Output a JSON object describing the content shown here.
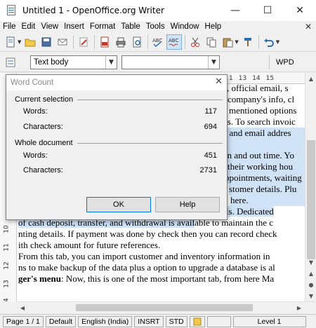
{
  "window": {
    "title": "Untitled 1 - OpenOffice.org Writer",
    "controls": {
      "minimize": "—",
      "maximize": "☐",
      "close": "✕"
    }
  },
  "menubar": {
    "items": [
      "File",
      "Edit",
      "View",
      "Insert",
      "Format",
      "Table",
      "Tools",
      "Window",
      "Help"
    ],
    "close_glyph": "✕"
  },
  "toolbar": {
    "icons": [
      "new-icon",
      "open-icon",
      "save-icon",
      "email-icon",
      "edit-file-icon",
      "export-pdf-icon",
      "print-icon",
      "page-preview-icon",
      "spellcheck-icon",
      "autospellcheck-icon",
      "cut-icon",
      "copy-icon",
      "paste-icon",
      "format-paintbrush-icon",
      "undo-icon"
    ]
  },
  "formatting": {
    "paragraph_style": "Text body",
    "font_name": "",
    "wpd_label": "WPD"
  },
  "ruler": {
    "ticks": [
      "1",
      "13",
      "14",
      "15"
    ]
  },
  "vruler": {
    "numbers": [
      "10",
      "11",
      "12",
      "13",
      "14",
      "15",
      "16"
    ]
  },
  "document": {
    "lines": [
      {
        "pre": "",
        "text": "s, official email, s",
        "hl": false
      },
      {
        "pre": "",
        "text": "company's info, cl",
        "hl": false
      },
      {
        "pre": "",
        "text": "mentioned options",
        "hl": false
      },
      {
        "pre": "",
        "text": "es. To search invoic",
        "hl": false
      },
      {
        "pre": "",
        "text": ", and email addres",
        "hl": true
      },
      {
        "pre": "",
        "text": "",
        "hl": true
      },
      {
        "pre": "",
        "text": "in and out time. Yo",
        "hl": true
      },
      {
        "pre": "",
        "text": "their working hou",
        "hl": true
      },
      {
        "pre": "",
        "text": "ppointments, waiting",
        "hl": true
      },
      {
        "pre": "",
        "text": "stomer details. Plu",
        "hl": true
      },
      {
        "pre": "",
        "text": "here.",
        "hl": true
      },
      {
        "pre_bold": "inting",
        "text": ": You can add, view, and edit various account details. Dedicated",
        "hl": true
      },
      {
        "pre": "",
        "text": " of cash deposit, transfer, and withdrawal is avail",
        "tail": "able to maintain the c",
        "hl": true
      },
      {
        "pre": "",
        "text": "nting details. If payment was done by check then you can record check",
        "hl": false
      },
      {
        "pre": "",
        "text": "ith check amount for future references.",
        "hl": false
      },
      {
        "pre": "",
        "text": " From this tab, you can import customer and inventory information in",
        "hl": false
      },
      {
        "pre": "",
        "text": "ns to make backup of the data plus a option to upgrade a database is al",
        "hl": false
      },
      {
        "pre_bold": "ger's menu",
        "text": ": Now, this is one of the most important tab, from here Ma",
        "hl": false
      }
    ]
  },
  "statusbar": {
    "page": "Page 1 / 1",
    "style": "Default",
    "language": "English (India)",
    "insert_mode": "INSRT",
    "selection_mode": "STD",
    "level": "Level 1"
  },
  "word_count_dialog": {
    "title": "Word Count",
    "current_selection": {
      "heading": "Current selection",
      "words_label": "Words:",
      "words": "117",
      "characters_label": "Characters:",
      "characters": "694"
    },
    "whole_document": {
      "heading": "Whole document",
      "words_label": "Words:",
      "words": "451",
      "characters_label": "Characters:",
      "characters": "2731"
    },
    "ok_label": "OK",
    "help_label": "Help"
  }
}
